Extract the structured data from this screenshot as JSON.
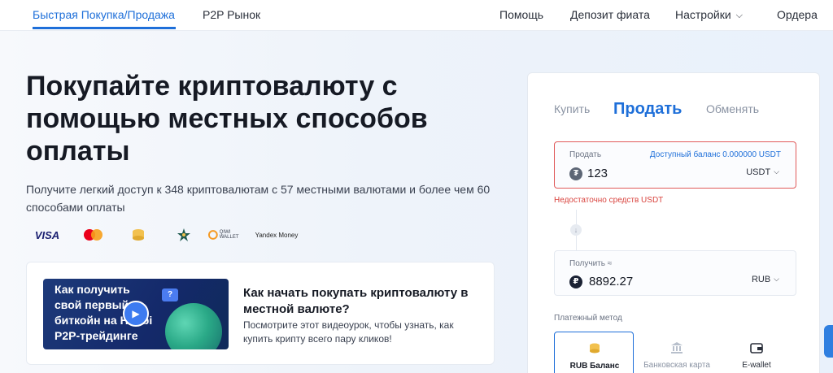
{
  "nav": {
    "tabs": [
      {
        "label": "Быстрая Покупка/Продажа",
        "active": true
      },
      {
        "label": "P2P Рынок",
        "active": false
      }
    ],
    "right_items": [
      "Помощь",
      "Депозит фиата",
      "Настройки",
      "Ордера"
    ]
  },
  "hero": {
    "title": "Покупайте криптовалюту с помощью местных способов оплаты",
    "subtitle": "Получите легкий доступ к 348 криптовалютам с 57 местными валютами и более чем 60 способами оплаты"
  },
  "payment_logos": {
    "visa": "VISA",
    "qiwi": "QIWI WALLET",
    "yandex": "Yandex Money"
  },
  "video": {
    "thumb_lines": [
      "Как получить",
      "свой первый",
      "биткойн на Huobi",
      "P2P-трейдинге"
    ],
    "thumb_badge": "?",
    "title": "Как начать покупать криптовалюту в местной валюте?",
    "description": "Посмотрите этот видеоурок, чтобы узнать, как купить крипту всего пару кликов!"
  },
  "trade": {
    "tabs": [
      {
        "label": "Купить",
        "active": false
      },
      {
        "label": "Продать",
        "active": true
      },
      {
        "label": "Обменять",
        "active": false
      }
    ],
    "sell": {
      "label": "Продать",
      "available": "Доступный баланс 0.000000 USDT",
      "value": "123",
      "currency": "USDT",
      "coin_icon": "tether-icon"
    },
    "error": "Недостаточно средств USDT",
    "get": {
      "label": "Получить ≈",
      "value": "8892.27",
      "currency": "RUB",
      "coin_icon": "ruble-icon"
    },
    "payment_method_label": "Платежный метод",
    "payment_methods": [
      {
        "label": "RUB Баланс",
        "active": true,
        "icon": "coins-icon"
      },
      {
        "label": "Банковская карта",
        "active": false,
        "icon": "bank-icon"
      },
      {
        "label": "E-wallet",
        "active": false,
        "icon": "wallet-icon"
      }
    ]
  },
  "colors": {
    "accent": "#1e6fd9",
    "error": "#d9443f",
    "tether": "#5d6675"
  }
}
